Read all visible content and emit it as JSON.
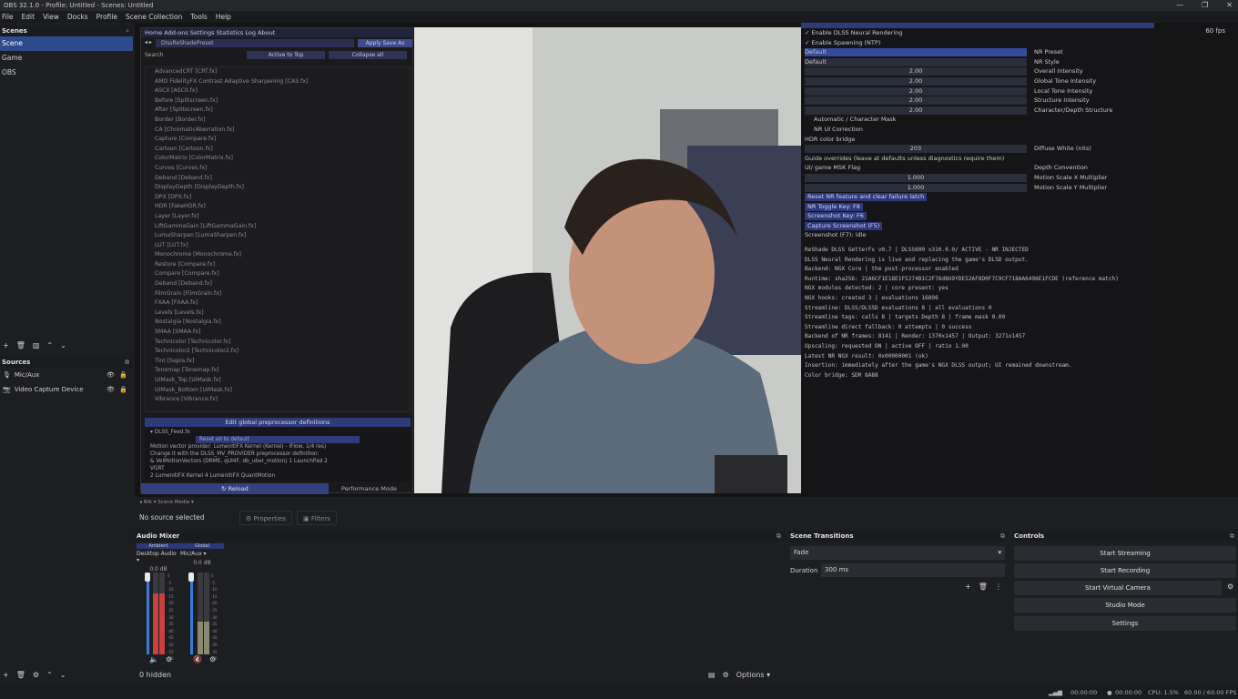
{
  "window": {
    "title": "OBS 32.1.0 - Profile: Untitled - Scenes: Untitled",
    "minimize": "—",
    "maximize": "❐",
    "close": "✕"
  },
  "menu": [
    "File",
    "Edit",
    "View",
    "Docks",
    "Profile",
    "Scene Collection",
    "Tools",
    "Help"
  ],
  "scenes": {
    "title": "Scenes",
    "items": [
      "Scene",
      "Game",
      "OBS"
    ],
    "selected": 0
  },
  "sources": {
    "title": "Sources",
    "items": [
      "Mic/Aux",
      "Video Capture Device"
    ]
  },
  "shader_panel": {
    "tabs": "Home  Add-ons  Settings  Statistics  Log  About",
    "preset": "DlssReShadePreset",
    "preset_button": "Apply Save As",
    "search": "Search",
    "active_to_top": "Active to Top",
    "collapse_all": "Collapse all",
    "effects": [
      "AdvancedCRT [CRT.fx]",
      "AMD FidelityFX Contrast Adaptive Sharpening [CAS.fx]",
      "ASCII [ASCII.fx]",
      "Before [Splitscreen.fx]",
      "After [Splitscreen.fx]",
      "Border [Border.fx]",
      "CA [ChromaticAberration.fx]",
      "Capture [Compare.fx]",
      "Cartoon [Cartoon.fx]",
      "ColorMatrix [ColorMatrix.fx]",
      "Curves [Curves.fx]",
      "Deband [Deband.fx]",
      "DisplayDepth [DisplayDepth.fx]",
      "DPX [DPX.fx]",
      "HDR [FakeHDR.fx]",
      "Layer [Layer.fx]",
      "LiftGammaGain [LiftGammaGain.fx]",
      "LumaSharpen [LumaSharpen.fx]",
      "LUT [LUT.fx]",
      "Monochrome [Monochrome.fx]",
      "Restore [Compare.fx]",
      "Compare [Compare.fx]",
      "Deband [Deband.fx]",
      "FilmGrain [FilmGrain.fx]",
      "FXAA [FXAA.fx]",
      "Levels [Levels.fx]",
      "Nostalgia [Nostalgia.fx]",
      "SMAA [SMAA.fx]",
      "Technicolor [Technicolor.fx]",
      "Technicolor2 [Technicolor2.fx]",
      "Tint [Sepia.fx]",
      "Tonemap [Tonemap.fx]",
      "UIMask_Top [UIMask.fx]",
      "UIMask_Bottom [UIMask.fx]",
      "Vibrance [Vibrance.fx]"
    ],
    "definitions_header": "Edit global preprocessor definitions",
    "definitions_file": "▾ DLSS_Feed.fx",
    "reset_all": "Reset all to default",
    "def_lines": [
      "Motion vector provider: LumenitiFX Kernel (Kernel) - iFlow, 1/4 res)",
      "Change it with the DLSS_MV_PROVIDER preprocessor definition:",
      "  & VelMotionVectors (DRME, qUI4F, db_uber_motion)    1  LaunchPad    2",
      "VGRT",
      "  2 LumenitiFX Kernel      4 LumenitiFX QuantMotion"
    ],
    "reload": "↻ Reload",
    "performance_mode": "Performance Mode"
  },
  "dlss": {
    "enable_neural": "✓ Enable DLSS Neural Rendering",
    "enable_sampling": "✓ Enable Spawning (NTP)",
    "preset_value": "Default",
    "preset_label": "NR Preset",
    "style_value": "Default",
    "style_label": "NR Style",
    "sliders": [
      {
        "v": "2.00",
        "l": "Overall Intensity"
      },
      {
        "v": "2.00",
        "l": "Global Tone Intensity"
      },
      {
        "v": "2.00",
        "l": "Local Tone Intensity"
      },
      {
        "v": "2.00",
        "l": "Structure Intensity"
      },
      {
        "v": "2.00",
        "l": "Character/Depth Structure"
      }
    ],
    "automatic_mask": "Automatic / Character Mask",
    "nr_ui": "NR UI Correction",
    "hdr_bridge": "HDR color bridge",
    "diffuse_value": "203",
    "diffuse_label": "Diffuse White (nits)",
    "guide": "Guide overrides (leave at defaults unless diagnostics require them)",
    "ui_mask": "UI/ game MSK Flag",
    "depth_conv": "Depth Convention",
    "mv_x_value": "1.000",
    "mv_x_label": "Motion Scale X Multiplier",
    "mv_y_value": "1.000",
    "mv_y_label": "Motion Scale Y Multiplier",
    "reset_btn": "Reset NR feature and clear failure latch",
    "toggle_btn": "NR Toggle Key: F8",
    "screenshot_btn": "Screenshot Key: F6",
    "capture_btn": "Capture Screenshot (F5)",
    "screenshot_state": "Screenshot (F7): idle",
    "log": [
      "ReShade DLSS GetterFx v0.7 | DLSS600 v310.0.0/ ACTIVE - NR INJECTED",
      "DLSS Neural Rendering is live and replacing the game's DLSD output.",
      "Backend: NGX Core | the post-processor enabled",
      "Runtime: sha256: 21A6CF1E18E1F5274B1C2F76d8U9YDE52AF8D0F7C9CF718AA6496E1FCDE (reference match)",
      "NGX modules detected: 2 | core present: yes",
      "NGX hooks: created 3 | evaluations 16896",
      "Streamline: DLSS/DLSSD evaluations 8 | all evaluations 0",
      "Streamline tags: calls 8 | targets Depth 8 | frame mask 0.00",
      "Streamline direct fallback: 0 attempts | 0 success",
      "Backend of NR frames: 8141 | Render: 1370x1457 | Output: 3271x1457",
      "Upscaling: requested ON | active OFF | ratio 1.00",
      "Latest NR NGX result: 0x00000001 (ok)",
      "Insertion: immediately after the game's NGX DLSS output; UI remained downstream.",
      "Color bridge: SDR 8A88"
    ]
  },
  "fps": "60 fps",
  "scene_tabs": "◂    Ntk    ▾    Scene Media    ▾",
  "source_bar": {
    "none": "No source selected",
    "properties": "⚙ Properties",
    "filters": "▣ Filters"
  },
  "audio_mixer": {
    "title": "Audio Mixer",
    "channels": [
      {
        "group": "Ambient",
        "name": "Desktop Audio",
        "db": "0.0 dB"
      },
      {
        "group": "Global",
        "name": "Mic/Aux",
        "db": "0.0 dB"
      }
    ],
    "ticks": [
      "0",
      "-5",
      "-10",
      "-15",
      "-20",
      "-25",
      "-30",
      "-35",
      "-40",
      "-45",
      "-50",
      "-55",
      "-60"
    ],
    "hidden": "0 hidden",
    "options": "Options"
  },
  "scene_transitions": {
    "title": "Scene Transitions",
    "type": "Fade",
    "duration_label": "Duration",
    "duration": "300 ms"
  },
  "controls": {
    "title": "Controls",
    "buttons": [
      "Start Streaming",
      "Start Recording",
      "Start Virtual Camera",
      "Studio Mode",
      "Settings"
    ]
  },
  "status": {
    "rec": "00:00:00",
    "stream": "00:00:00",
    "cpu": "CPU: 1.5%",
    "fps": "60.00 / 60.00 FPS"
  },
  "levels": {
    "desktop_audio": 0.75,
    "mic_aux": 0.4
  }
}
